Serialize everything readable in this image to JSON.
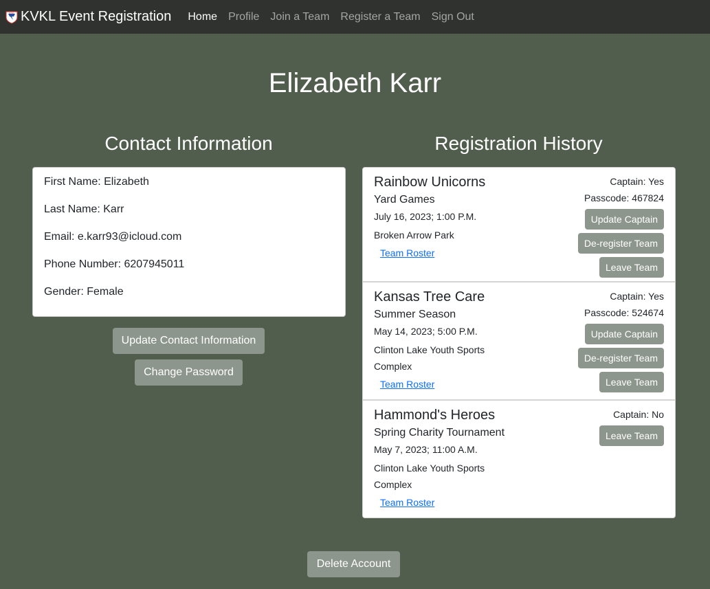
{
  "nav": {
    "brand": "KVKL Event Registration",
    "links": [
      "Home",
      "Profile",
      "Join a Team",
      "Register a Team",
      "Sign Out"
    ]
  },
  "page_title": "Elizabeth Karr",
  "contact": {
    "title": "Contact Information",
    "first_name": "First Name: Elizabeth",
    "last_name": "Last Name: Karr",
    "email": "Email: e.karr93@icloud.com",
    "phone": "Phone Number: 6207945011",
    "gender": "Gender: Female",
    "update_label": "Update Contact Information",
    "change_password_label": "Change Password"
  },
  "history": {
    "title": "Registration History",
    "items": [
      {
        "team": "Rainbow Unicorns",
        "event": "Yard Games",
        "date": "July 16, 2023; 1:00 P.M.",
        "location": "Broken Arrow Park",
        "roster": "Team Roster",
        "captain": "Captain: Yes",
        "passcode": "Passcode: 467824",
        "update_captain": "Update Captain",
        "deregister": "De-register Team",
        "leave": "Leave Team"
      },
      {
        "team": "Kansas Tree Care",
        "event": "Summer Season",
        "date": "May 14, 2023; 5:00 P.M.",
        "location": "Clinton Lake Youth Sports Complex",
        "roster": "Team Roster",
        "captain": "Captain: Yes",
        "passcode": "Passcode: 524674",
        "update_captain": "Update Captain",
        "deregister": "De-register Team",
        "leave": "Leave Team"
      },
      {
        "team": "Hammond's Heroes",
        "event": "Spring Charity Tournament",
        "date": "May 7, 2023; 11:00 A.M.",
        "location": "Clinton Lake Youth Sports Complex",
        "roster": "Team Roster",
        "captain": "Captain: No",
        "leave": "Leave Team"
      }
    ]
  },
  "delete_label": "Delete Account",
  "colors": {
    "background": "#515e4d",
    "navbar": "#2f322f",
    "button": "#8d968c",
    "link": "#0d6efd"
  }
}
